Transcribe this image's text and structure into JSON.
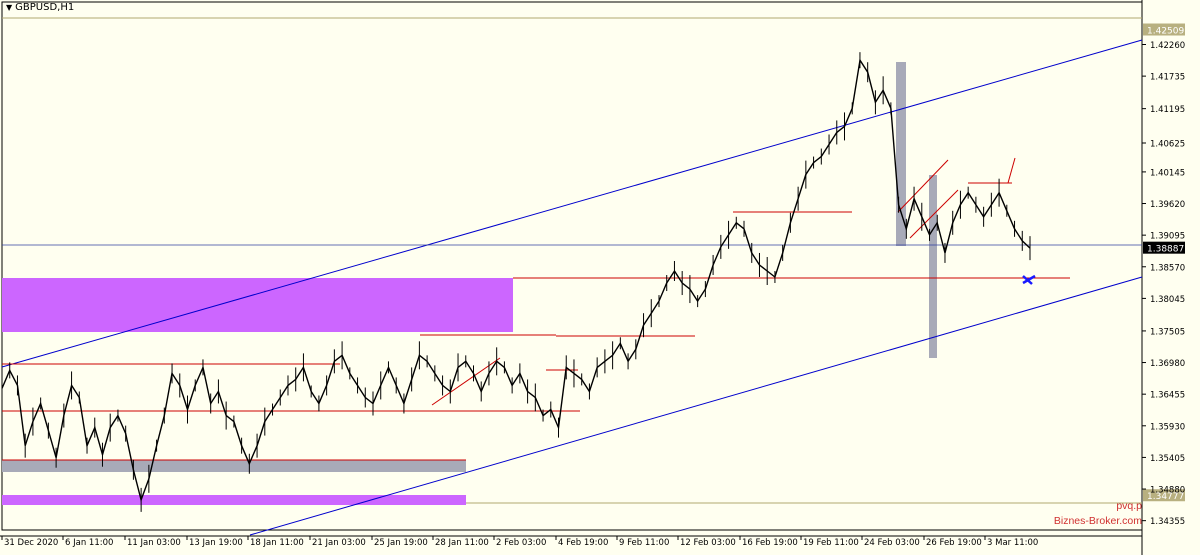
{
  "window": {
    "title": "GBPUSD,H1"
  },
  "watermark": {
    "line1": "pvq.p",
    "line2": "Biznes-Broker.com"
  },
  "colors": {
    "background": "#fffff0",
    "candles": "#000000",
    "channel": "#0000cc",
    "levels": "#cc0000",
    "zone_purple": "#cc66ff",
    "zone_gray": "#a8aab8",
    "price_tag": "#000000",
    "marker": "#1a1aff"
  },
  "chart_data": {
    "type": "candlestick",
    "symbol": "GBPUSD",
    "timeframe": "H1",
    "ylim": [
      1.342,
      1.427
    ],
    "y_ticks": [
      "1.42260",
      "1.41735",
      "1.41195",
      "1.40625",
      "1.40145",
      "1.39620",
      "1.39095",
      "1.38570",
      "1.38045",
      "1.37505",
      "1.36980",
      "1.36455",
      "1.35930",
      "1.35405",
      "1.34880",
      "1.34355"
    ],
    "x_ticks": [
      "31 Dec 2020",
      "6 Jan 11:00",
      "11 Jan 03:00",
      "13 Jan 19:00",
      "18 Jan 11:00",
      "21 Jan 03:00",
      "25 Jan 19:00",
      "28 Jan 11:00",
      "2 Feb 03:00",
      "4 Feb 19:00",
      "9 Feb 11:00",
      "12 Feb 03:00",
      "16 Feb 19:00",
      "19 Feb 11:00",
      "24 Feb 03:00",
      "26 Feb 19:00",
      "3 Mar 11:00"
    ],
    "price_labels": {
      "top": "1.42509",
      "current": "1.38887",
      "bottom": "1.34777"
    },
    "path_points": [
      [
        0,
        1.3655
      ],
      [
        1,
        1.3685
      ],
      [
        2,
        1.366
      ],
      [
        3,
        1.356
      ],
      [
        4,
        1.36
      ],
      [
        5,
        1.363
      ],
      [
        6,
        1.3585
      ],
      [
        7,
        1.354
      ],
      [
        8,
        1.361
      ],
      [
        9,
        1.366
      ],
      [
        10,
        1.364
      ],
      [
        11,
        1.356
      ],
      [
        12,
        1.359
      ],
      [
        13,
        1.3545
      ],
      [
        14,
        1.359
      ],
      [
        15,
        1.361
      ],
      [
        16,
        1.358
      ],
      [
        17,
        1.352
      ],
      [
        18,
        1.347
      ],
      [
        19,
        1.3505
      ],
      [
        20,
        1.356
      ],
      [
        21,
        1.361
      ],
      [
        22,
        1.368
      ],
      [
        23,
        1.366
      ],
      [
        24,
        1.362
      ],
      [
        25,
        1.366
      ],
      [
        26,
        1.369
      ],
      [
        27,
        1.363
      ],
      [
        28,
        1.365
      ],
      [
        29,
        1.361
      ],
      [
        30,
        1.36
      ],
      [
        31,
        1.356
      ],
      [
        32,
        1.353
      ],
      [
        33,
        1.356
      ],
      [
        34,
        1.36
      ],
      [
        35,
        1.362
      ],
      [
        36,
        1.364
      ],
      [
        37,
        1.366
      ],
      [
        38,
        1.367
      ],
      [
        39,
        1.369
      ],
      [
        40,
        1.365
      ],
      [
        41,
        1.363
      ],
      [
        42,
        1.366
      ],
      [
        43,
        1.37
      ],
      [
        44,
        1.371
      ],
      [
        45,
        1.368
      ],
      [
        46,
        1.366
      ],
      [
        47,
        1.364
      ],
      [
        48,
        1.363
      ],
      [
        49,
        1.366
      ],
      [
        50,
        1.369
      ],
      [
        51,
        1.366
      ],
      [
        52,
        1.363
      ],
      [
        53,
        1.367
      ],
      [
        54,
        1.371
      ],
      [
        55,
        1.37
      ],
      [
        56,
        1.368
      ],
      [
        57,
        1.366
      ],
      [
        58,
        1.365
      ],
      [
        59,
        1.369
      ],
      [
        60,
        1.37
      ],
      [
        61,
        1.368
      ],
      [
        62,
        1.365
      ],
      [
        63,
        1.368
      ],
      [
        64,
        1.37
      ],
      [
        65,
        1.369
      ],
      [
        66,
        1.366
      ],
      [
        67,
        1.368
      ],
      [
        68,
        1.365
      ],
      [
        69,
        1.364
      ],
      [
        70,
        1.361
      ],
      [
        71,
        1.362
      ],
      [
        72,
        1.359
      ],
      [
        73,
        1.369
      ],
      [
        74,
        1.368
      ],
      [
        75,
        1.367
      ],
      [
        76,
        1.365
      ],
      [
        77,
        1.369
      ],
      [
        78,
        1.37
      ],
      [
        79,
        1.371
      ],
      [
        80,
        1.373
      ],
      [
        81,
        1.37
      ],
      [
        82,
        1.372
      ],
      [
        83,
        1.376
      ],
      [
        84,
        1.378
      ],
      [
        85,
        1.38
      ],
      [
        86,
        1.383
      ],
      [
        87,
        1.385
      ],
      [
        88,
        1.383
      ],
      [
        89,
        1.382
      ],
      [
        90,
        1.38
      ],
      [
        91,
        1.382
      ],
      [
        92,
        1.386
      ],
      [
        93,
        1.389
      ],
      [
        94,
        1.391
      ],
      [
        95,
        1.393
      ],
      [
        96,
        1.392
      ],
      [
        97,
        1.388
      ],
      [
        98,
        1.386
      ],
      [
        99,
        1.385
      ],
      [
        100,
        1.384
      ],
      [
        101,
        1.388
      ],
      [
        102,
        1.393
      ],
      [
        103,
        1.397
      ],
      [
        104,
        1.401
      ],
      [
        105,
        1.403
      ],
      [
        106,
        1.404
      ],
      [
        107,
        1.406
      ],
      [
        108,
        1.408
      ],
      [
        109,
        1.409
      ],
      [
        110,
        1.412
      ],
      [
        111,
        1.42
      ],
      [
        112,
        1.418
      ],
      [
        113,
        1.413
      ],
      [
        114,
        1.415
      ],
      [
        115,
        1.412
      ],
      [
        116,
        1.396
      ],
      [
        117,
        1.392
      ],
      [
        118,
        1.397
      ],
      [
        119,
        1.394
      ],
      [
        120,
        1.391
      ],
      [
        121,
        1.393
      ],
      [
        122,
        1.388
      ],
      [
        123,
        1.393
      ],
      [
        124,
        1.396
      ],
      [
        125,
        1.398
      ],
      [
        126,
        1.396
      ],
      [
        127,
        1.394
      ],
      [
        128,
        1.396
      ],
      [
        129,
        1.398
      ],
      [
        130,
        1.395
      ],
      [
        131,
        1.392
      ],
      [
        132,
        1.39
      ],
      [
        133,
        1.3888
      ]
    ],
    "x_start_time_index": 0,
    "x_end_time_index": 133
  }
}
